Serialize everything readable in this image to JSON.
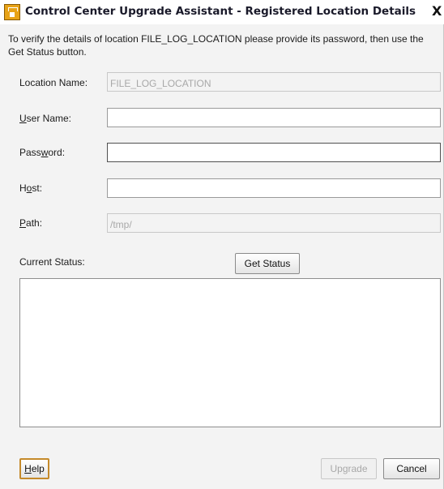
{
  "window": {
    "title": "Control Center Upgrade Assistant - Registered Location Details",
    "close_glyph": "X"
  },
  "description": "To verify the details of location FILE_LOG_LOCATION please provide its password, then use the Get Status button.",
  "form": {
    "location_name": {
      "label": "Location Name:",
      "value": "FILE_LOG_LOCATION"
    },
    "user_name": {
      "label_pre": "",
      "label_u": "U",
      "label_post": "ser Name:",
      "value": ""
    },
    "password": {
      "label_pre": "Pass",
      "label_u": "w",
      "label_post": "ord:",
      "value": ""
    },
    "host": {
      "label_pre": "H",
      "label_u": "o",
      "label_post": "st:",
      "value": ""
    },
    "path": {
      "label_pre": "",
      "label_u": "P",
      "label_post": "ath:",
      "value": "/tmp/"
    }
  },
  "status": {
    "label": "Current Status:",
    "button_label": "Get Status",
    "text": ""
  },
  "footer": {
    "help_pre": "",
    "help_u": "H",
    "help_post": "elp",
    "upgrade_label": "Upgrade",
    "cancel_label": "Cancel"
  },
  "colors": {
    "help_border": "#c58a2a",
    "disabled_text": "#a8a8a8",
    "app_icon": "#e8a317"
  },
  "icons": {
    "app": "upgrade-assistant-icon",
    "close": "close-icon"
  }
}
